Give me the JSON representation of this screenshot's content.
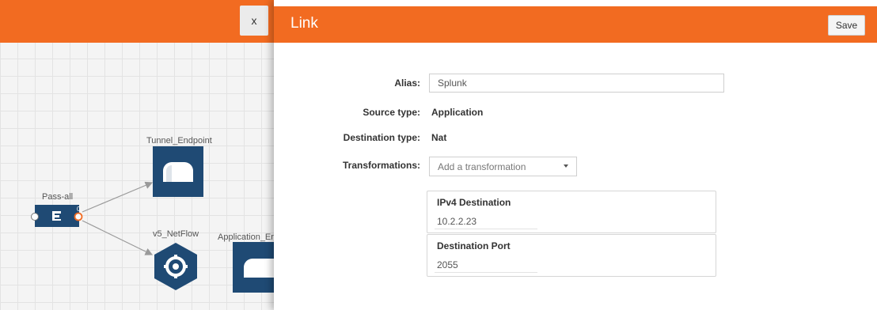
{
  "canvas": {
    "close_label": "x",
    "nodes": {
      "pass_all": "Pass-all",
      "tunnel_endpoint": "Tunnel_Endpoint",
      "v5_netflow": "v5_NetFlow",
      "application_endpoint": "Application_En",
      "port_count": "0"
    }
  },
  "panel": {
    "title": "Link",
    "save_label": "Save",
    "alias": {
      "label": "Alias:",
      "value": "Splunk"
    },
    "source_type": {
      "label": "Source type:",
      "value": "Application"
    },
    "destination_type": {
      "label": "Destination type:",
      "value": "Nat"
    },
    "transformations": {
      "label": "Transformations:",
      "placeholder": "Add a transformation",
      "items": [
        {
          "title": "IPv4 Destination",
          "value": "10.2.2.23"
        },
        {
          "title": "Destination Port",
          "value": "2055"
        }
      ]
    }
  },
  "colors": {
    "accent": "#f26b21",
    "node_fill": "#1f4a74",
    "canvas_bg": "#f4f4f4"
  },
  "icons": [
    "close-icon",
    "filter-icon",
    "tunnel-icon",
    "gear-icon",
    "caret-down-icon"
  ]
}
